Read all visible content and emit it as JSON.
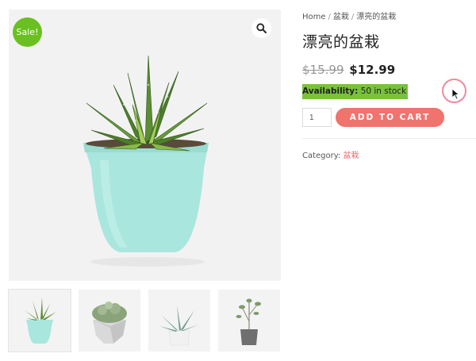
{
  "gallery": {
    "badge": "Sale!",
    "zoom_icon": "magnifier-icon",
    "thumbnails": [
      "aloe-pot-thumb",
      "succulent-stone-pot-thumb",
      "agave-white-pot-thumb",
      "sprout-grey-pot-thumb"
    ]
  },
  "breadcrumb": {
    "home": "Home",
    "separator": "/",
    "category": "盆栽",
    "current": "漂亮的盆栽"
  },
  "product": {
    "title": "漂亮的盆栽",
    "old_price": "$15.99",
    "new_price": "$12.99",
    "availability_label": "Availability:",
    "availability_value": "50 in stock",
    "quantity": "1",
    "add_to_cart": "ADD TO CART",
    "category_label": "Category:",
    "category_value": "盆栽"
  },
  "colors": {
    "sale_badge": "#69c020",
    "availability_highlight": "#78c23c",
    "add_to_cart": "#f0736e",
    "category_link": "#ee6a6a",
    "pot": "#a9e6de"
  }
}
